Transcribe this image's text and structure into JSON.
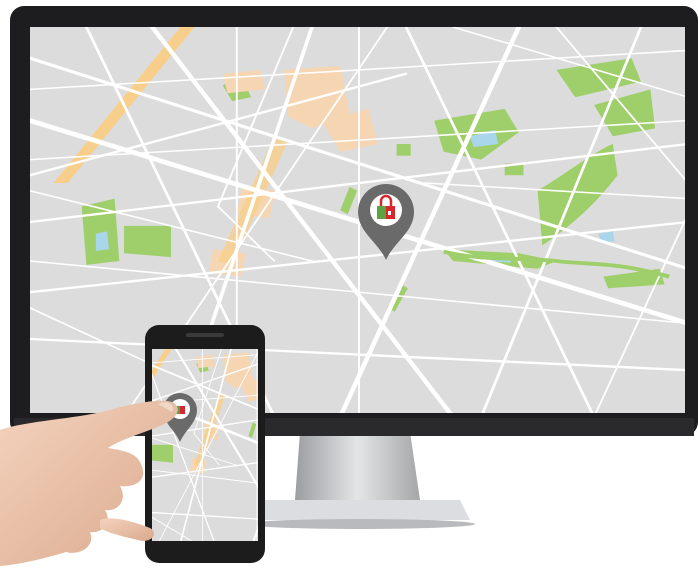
{
  "scene": {
    "description_hidden": "",
    "monitor": {
      "bezel_color": "#1d1d1f",
      "stand_color": "#cfd0d2"
    },
    "map": {
      "background": "#dddddd",
      "road_color": "#ffffff",
      "park_color": "#9fcf6a",
      "water_color": "#a9d6ea",
      "highway_color": "#f8cf8a",
      "building_color": "#f6d5b3"
    },
    "location_pin": {
      "color": "#6a6a6a",
      "lock_icon_colors": [
        "#d7262d",
        "#5ea33f"
      ]
    },
    "phone": {
      "body_color": "#1c1c1c",
      "screen_map_visible": true
    }
  }
}
